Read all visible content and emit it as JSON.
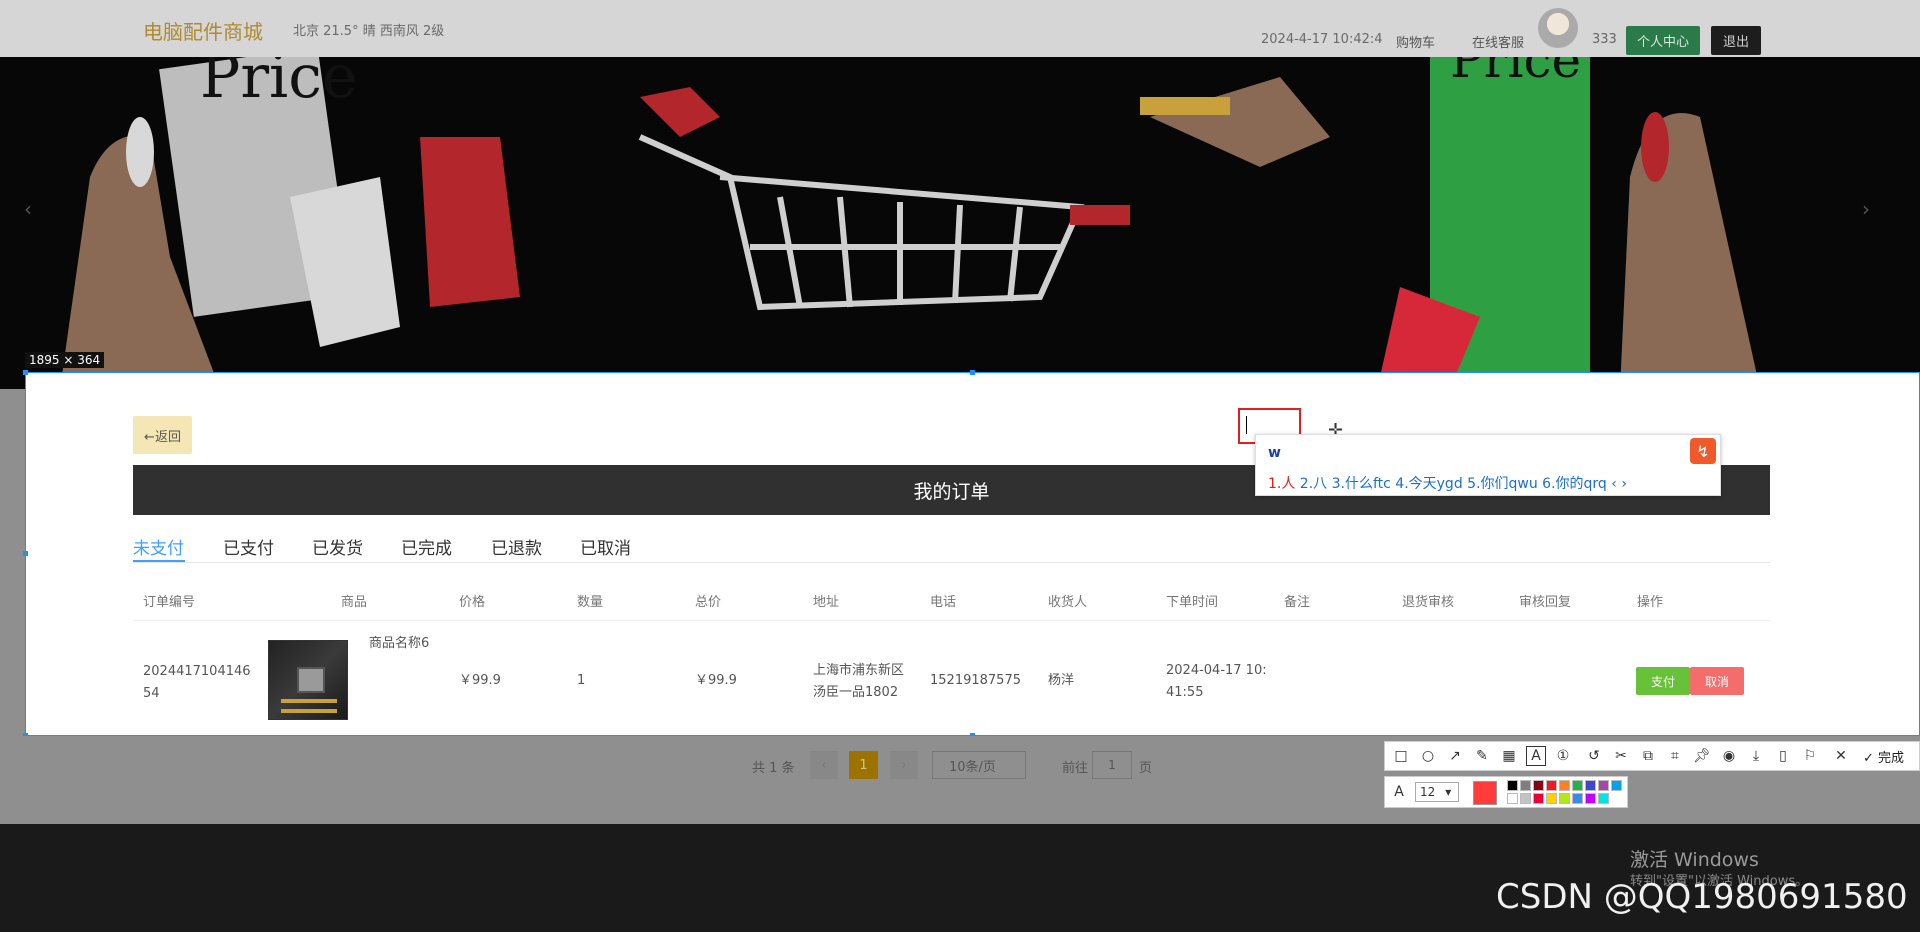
{
  "header": {
    "logo": "电脑配件商城",
    "weather": "北京  21.5°  晴  西南风  2级",
    "time": "2024-4-17 10:42:4",
    "nav_cart": "购物车",
    "nav_service": "在线客服",
    "username": "333",
    "btn_center": "个人中心",
    "btn_logout": "退出"
  },
  "banner": {
    "arrow_left": "‹",
    "arrow_right": "›"
  },
  "selection": {
    "size_label": "1895 × 364"
  },
  "orders": {
    "back_label": "←返回",
    "title": "我的订单",
    "tabs": [
      "未支付",
      "已支付",
      "已发货",
      "已完成",
      "已退款",
      "已取消"
    ],
    "columns": [
      "订单编号",
      "商品",
      "价格",
      "数量",
      "总价",
      "地址",
      "电话",
      "收货人",
      "下单时间",
      "备注",
      "退货审核",
      "审核回复",
      "操作"
    ],
    "row": {
      "order_no_1": "2024417104146",
      "order_no_2": "54",
      "product_name": "商品名称6",
      "price": "￥99.9",
      "qty": "1",
      "total": "￥99.9",
      "address_1": "上海市浦东新区",
      "address_2": "汤臣一品1802",
      "phone": "15219187575",
      "receiver": "杨洋",
      "time_1": "2024-04-17 10:",
      "time_2": "41:55",
      "pay_label": "支付",
      "cancel_label": "取消"
    }
  },
  "pagination": {
    "total": "共 1 条",
    "prev": "‹",
    "page": "1",
    "next": "›",
    "page_size": "10条/页",
    "goto": "前往",
    "goto_value": "1",
    "unit": "页"
  },
  "ime": {
    "input": "w",
    "candidates_first": "1.人",
    "candidates_rest": " 2.八 3.什么ftc 4.今天ygd 5.你们qwu 6.你的qrq ‹ ›"
  },
  "toolbar": {
    "done_label": "✓ 完成",
    "font_size": "12",
    "current_color": "#ff3b3b",
    "palette": [
      "#000000",
      "#7f7f7f",
      "#880015",
      "#ed1c24",
      "#ff7f27",
      "#22b14c",
      "#3f48cc",
      "#a349a4",
      "#00a2e8",
      "#ffffff",
      "#c3c3c3",
      "#e8003d",
      "#ffd000",
      "#b5e61d",
      "#3f8ae6",
      "#c000ff",
      "#00e5e5"
    ]
  },
  "os": {
    "activate_title": "激活 Windows",
    "activate_sub": "转到\"设置\"以激活 Windows。"
  },
  "watermark": "CSDN @QQ1980691580"
}
